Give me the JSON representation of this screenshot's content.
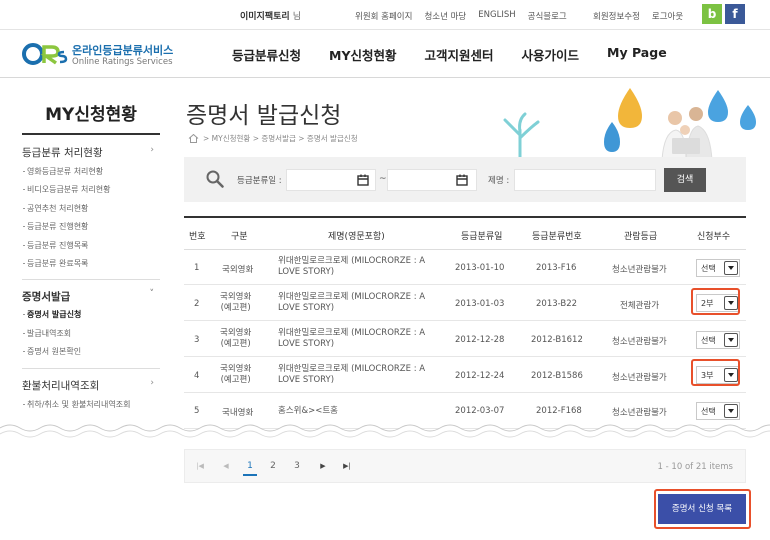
{
  "topbar": {
    "user_name": "이미지팩토리",
    "user_suffix": "님",
    "links": [
      "위원회 홈페이지",
      "청소년 마당",
      "ENGLISH",
      "공식블로그"
    ],
    "account_links": [
      "회원정보수정",
      "로그아웃"
    ],
    "sns": [
      "b",
      "f"
    ]
  },
  "logo": {
    "korean": "온라인등급분류서비스",
    "english": "Online Ratings Services"
  },
  "nav": [
    "등급분류신청",
    "MY신청현황",
    "고객지원센터",
    "사용가이드",
    "My Page"
  ],
  "sidebar": {
    "title": "MY신청현황",
    "sections": [
      {
        "label": "등급분류 처리현황",
        "items": [
          "영화등급분류 처리현황",
          "비디오등급분류 처리현황",
          "공연추천 처리현황",
          "등급분류 진행현황",
          "등급분류 진행목록",
          "등급분류 완료목록"
        ]
      },
      {
        "label": "증명서발급",
        "items": [
          "증명서 발급신청",
          "발급내역조회",
          "증명서 원본확인"
        ]
      },
      {
        "label": "환불처리내역조회",
        "items": [
          "취하/취소 및 환불처리내역조회"
        ]
      }
    ]
  },
  "page": {
    "title": "증명서 발급신청",
    "breadcrumb": "> MY신청현황 > 증명서발급 > 증명서 발급신청"
  },
  "search": {
    "date_label": "등급분류일 :",
    "tilde": "~",
    "title_label": "제명 :",
    "button": "검색"
  },
  "table": {
    "headers": [
      "번호",
      "구분",
      "제명(영문포함)",
      "등급분류일",
      "등급분류번호",
      "관람등급",
      "신청부수"
    ],
    "rows": [
      {
        "no": "1",
        "type": "국외영화",
        "title": "위대한밀로르크로제 (MILOCRORZE : A LOVE STORY)",
        "date": "2013-01-10",
        "code": "2013-F16",
        "rating": "청소년관람불가",
        "qty": "선택"
      },
      {
        "no": "2",
        "type": "국외영화\n(예고편)",
        "title": "위대한밀로르크로제 (MILOCRORZE : A LOVE STORY)",
        "date": "2013-01-03",
        "code": "2013-B22",
        "rating": "전체관람가",
        "qty": "2부"
      },
      {
        "no": "3",
        "type": "국외영화\n(예고편)",
        "title": "위대한밀로르크로제 (MILOCRORZE : A LOVE STORY)",
        "date": "2012-12-28",
        "code": "2012-B1612",
        "rating": "청소년관람불가",
        "qty": "선택"
      },
      {
        "no": "4",
        "type": "국외영화\n(예고편)",
        "title": "위대한밀로르크로제 (MILOCRORZE : A LOVE STORY)",
        "date": "2012-12-24",
        "code": "2012-B1586",
        "rating": "청소년관람불가",
        "qty": "3부"
      },
      {
        "no": "5",
        "type": "국내영화",
        "title": "홈스위&><트홈",
        "date": "2012-03-07",
        "code": "2012-F168",
        "rating": "청소년관람불가",
        "qty": "선택"
      }
    ]
  },
  "pagination": {
    "pages": [
      "1",
      "2",
      "3"
    ],
    "current": "1",
    "info": "1 - 10 of 21 items"
  },
  "list_button": "증명서 신청 목록",
  "colors": {
    "accent": "#3b4fa8",
    "highlight": "#e8502b",
    "active_page": "#1c74b9",
    "banner_drop": "#4aa3e0"
  }
}
